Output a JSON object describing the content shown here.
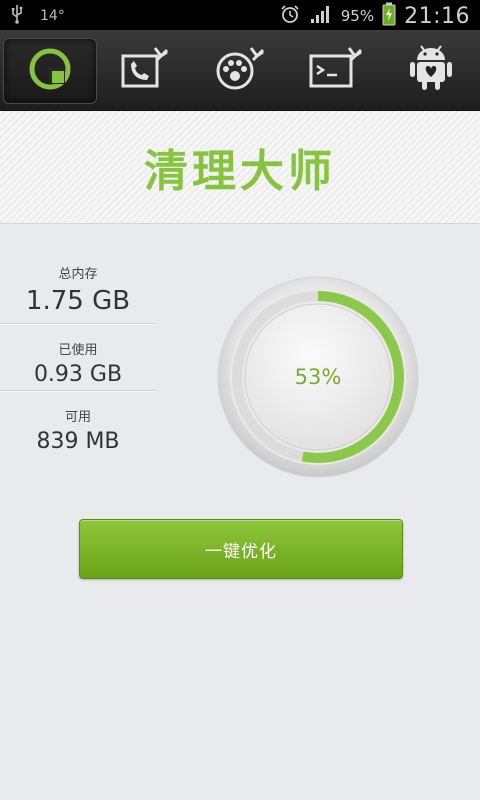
{
  "status_bar": {
    "notification_count": "14°",
    "battery_percent": "95%",
    "time": "21:16",
    "icons": [
      "usb-icon",
      "alarm-icon",
      "signal-icon",
      "battery-charging-icon"
    ]
  },
  "tabs": [
    {
      "icon": "cleaner-app-icon",
      "active": true
    },
    {
      "icon": "call-log-clean-icon",
      "active": false
    },
    {
      "icon": "app-cache-clean-icon",
      "active": false
    },
    {
      "icon": "terminal-clean-icon",
      "active": false
    },
    {
      "icon": "android-icon",
      "active": false
    }
  ],
  "banner": {
    "title": "清理大师"
  },
  "memory": {
    "total_label": "总内存",
    "total_value": "1.75 GB",
    "used_label": "已使用",
    "used_value": "0.93 GB",
    "available_label": "可用",
    "available_value": "839 MB"
  },
  "gauge": {
    "percent_text": "53%",
    "percent": 53
  },
  "action_button": {
    "label": "一键优化"
  },
  "colors": {
    "accent_green": "#86c440",
    "gauge_green": "#8cc94a",
    "button_green": "#7cb52a"
  }
}
